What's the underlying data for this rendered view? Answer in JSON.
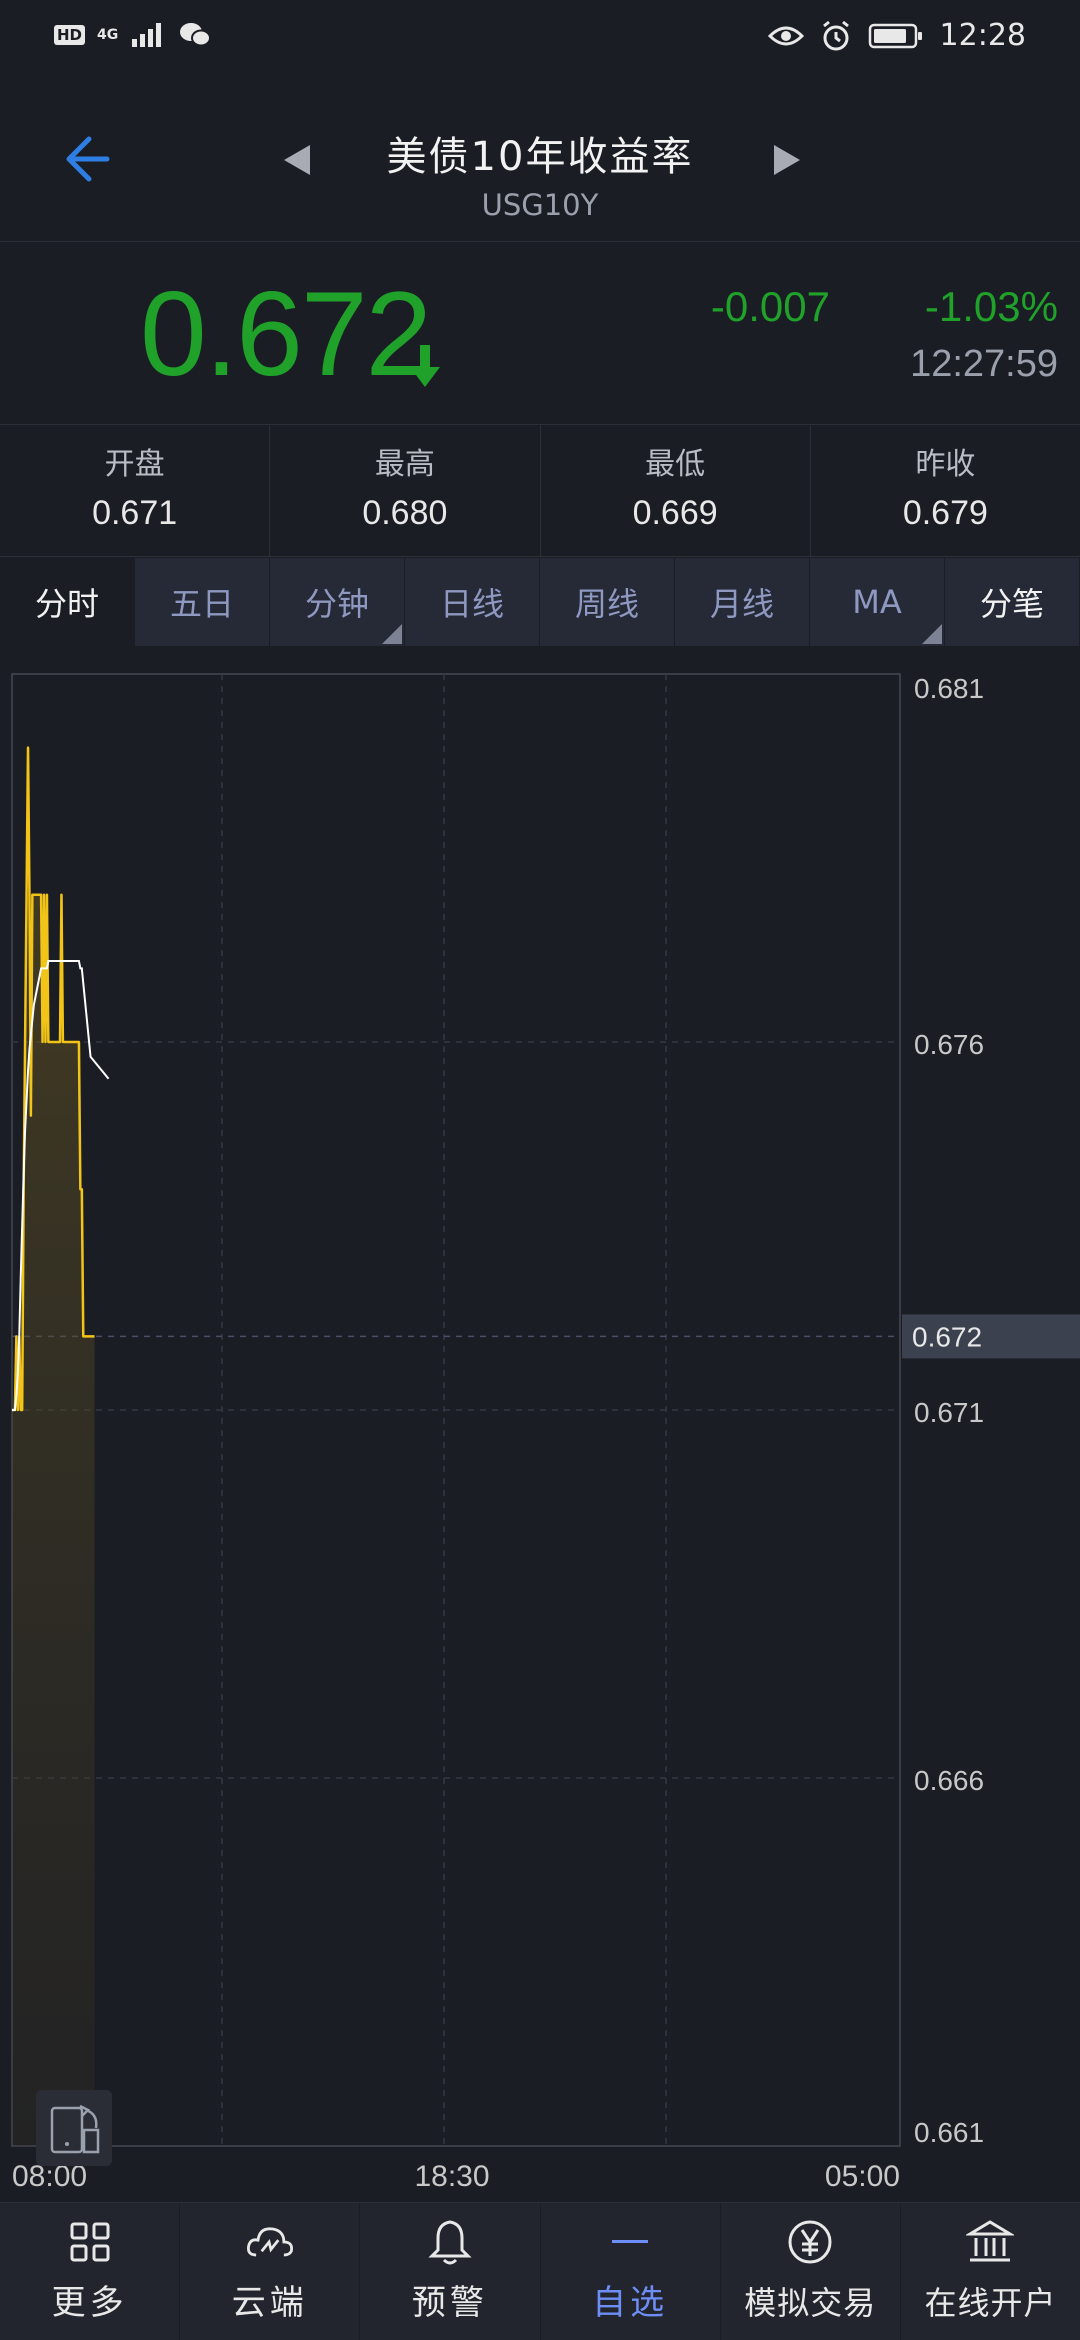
{
  "status_bar": {
    "hd": "HD",
    "network": "4G",
    "time": "12:28"
  },
  "header": {
    "title": "美债10年收益率",
    "symbol": "USG10Y"
  },
  "quote": {
    "price": "0.672",
    "change": "-0.007",
    "change_pct": "-1.03%",
    "time": "12:27:59",
    "color": "#1fa12a"
  },
  "ohlc": [
    {
      "label": "开盘",
      "value": "0.671"
    },
    {
      "label": "最高",
      "value": "0.680"
    },
    {
      "label": "最低",
      "value": "0.669"
    },
    {
      "label": "昨收",
      "value": "0.679"
    }
  ],
  "tabs": [
    {
      "label": "分时",
      "active": true
    },
    {
      "label": "五日"
    },
    {
      "label": "分钟",
      "dropdown": true
    },
    {
      "label": "日线"
    },
    {
      "label": "周线"
    },
    {
      "label": "月线"
    },
    {
      "label": "MA",
      "dropdown": true
    },
    {
      "label": "分笔"
    }
  ],
  "chart_data": {
    "type": "line",
    "y_ticks": [
      "0.681",
      "0.676",
      "0.671",
      "0.666",
      "0.661"
    ],
    "ylim": [
      0.661,
      0.681
    ],
    "x_ticks": [
      "08:00",
      "18:30",
      "05:00"
    ],
    "current_price_label": "0.672",
    "current_price": 0.672,
    "reference_price": 0.671,
    "series": [
      {
        "color": "#f2c418",
        "values": [
          0.671,
          0.671,
          0.671,
          0.672,
          0.671,
          0.672,
          0.671,
          0.671,
          0.674,
          0.676,
          0.678,
          0.68,
          0.678,
          0.675,
          0.678,
          0.678,
          0.678,
          0.678,
          0.678,
          0.678,
          0.678,
          0.676,
          0.678,
          0.676,
          0.678,
          0.676,
          0.676,
          0.676,
          0.676,
          0.676,
          0.676,
          0.676,
          0.676,
          0.676,
          0.678,
          0.676,
          0.676,
          0.676,
          0.676,
          0.676,
          0.676,
          0.676,
          0.676,
          0.676,
          0.676,
          0.676,
          0.676,
          0.674,
          0.674,
          0.672,
          0.672,
          0.672,
          0.672,
          0.672,
          0.672
        ]
      },
      {
        "color": "#ffffff",
        "values": [
          0.671,
          0.671,
          0.671,
          0.6712,
          0.6715,
          0.672,
          0.6728,
          0.6735,
          0.6742,
          0.6748,
          0.6752,
          0.6756,
          0.6759,
          0.6761,
          0.6763,
          0.6765,
          0.6766,
          0.6767,
          0.6768,
          0.6769,
          0.677,
          0.677,
          0.677,
          0.677,
          0.677,
          0.6771,
          0.6771,
          0.6771,
          0.6771,
          0.6771,
          0.6771,
          0.6771,
          0.6771,
          0.6771,
          0.6771,
          0.6771,
          0.6771,
          0.6771,
          0.6771,
          0.6771,
          0.6771,
          0.6771,
          0.6771,
          0.6771,
          0.6771,
          0.6771,
          0.6771,
          0.677,
          0.677,
          0.6768,
          0.6766,
          0.6764,
          0.6762,
          0.676,
          0.6758
        ]
      }
    ],
    "total_points": 580
  },
  "bottom_nav": [
    {
      "label": "更多",
      "icon": "grid-icon"
    },
    {
      "label": "云端",
      "icon": "cloud-icon"
    },
    {
      "label": "预警",
      "icon": "bell-icon"
    },
    {
      "label": "自选",
      "icon": "dash-icon",
      "active": true
    },
    {
      "label": "模拟交易",
      "icon": "yen-icon"
    },
    {
      "label": "在线开户",
      "icon": "bank-icon"
    }
  ]
}
